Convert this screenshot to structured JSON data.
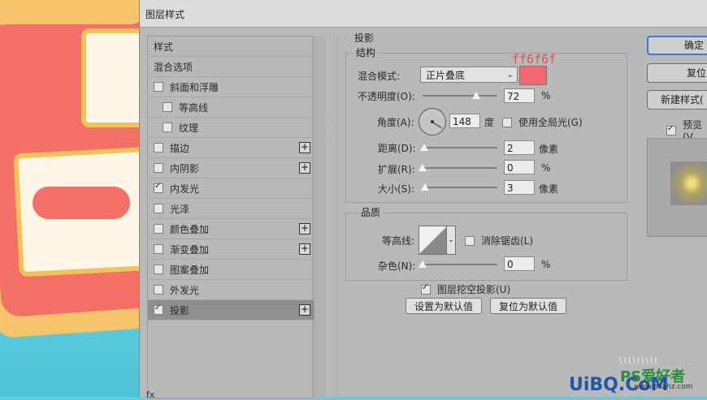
{
  "dialog": {
    "title": "图层样式"
  },
  "style_list": {
    "items": [
      {
        "label": "样式",
        "checkbox": false,
        "checked": false,
        "indent": 0,
        "plus": false,
        "active": false
      },
      {
        "label": "混合选项",
        "checkbox": false,
        "checked": false,
        "indent": 0,
        "plus": false,
        "active": false
      },
      {
        "label": "斜面和浮雕",
        "checkbox": true,
        "checked": false,
        "indent": 0,
        "plus": false,
        "active": false
      },
      {
        "label": "等高线",
        "checkbox": true,
        "checked": false,
        "indent": 1,
        "plus": false,
        "active": false
      },
      {
        "label": "纹理",
        "checkbox": true,
        "checked": false,
        "indent": 1,
        "plus": false,
        "active": false
      },
      {
        "label": "描边",
        "checkbox": true,
        "checked": false,
        "indent": 0,
        "plus": true,
        "active": false
      },
      {
        "label": "内阴影",
        "checkbox": true,
        "checked": false,
        "indent": 0,
        "plus": true,
        "active": false
      },
      {
        "label": "内发光",
        "checkbox": true,
        "checked": true,
        "indent": 0,
        "plus": false,
        "active": false
      },
      {
        "label": "光泽",
        "checkbox": true,
        "checked": false,
        "indent": 0,
        "plus": false,
        "active": false
      },
      {
        "label": "颜色叠加",
        "checkbox": true,
        "checked": false,
        "indent": 0,
        "plus": true,
        "active": false
      },
      {
        "label": "渐变叠加",
        "checkbox": true,
        "checked": false,
        "indent": 0,
        "plus": true,
        "active": false
      },
      {
        "label": "图案叠加",
        "checkbox": true,
        "checked": false,
        "indent": 0,
        "plus": false,
        "active": false
      },
      {
        "label": "外发光",
        "checkbox": true,
        "checked": false,
        "indent": 0,
        "plus": false,
        "active": false
      },
      {
        "label": "投影",
        "checkbox": true,
        "checked": true,
        "indent": 0,
        "plus": true,
        "active": true
      }
    ],
    "fx_label": "fx"
  },
  "drop_shadow": {
    "title": "投影",
    "structure": {
      "title": "结构",
      "blend_mode_label": "混合模式:",
      "blend_mode_value": "正片叠底",
      "color": "#f5676f",
      "color_annotation": "ff6f6f",
      "opacity_label": "不透明度(O):",
      "opacity_value": "72",
      "opacity_unit": "%",
      "angle_label": "角度(A):",
      "angle_value": "148",
      "angle_unit": "度",
      "global_light_label": "使用全局光(G)",
      "global_light_checked": false,
      "distance_label": "距离(D):",
      "distance_value": "2",
      "distance_unit": "像素",
      "spread_label": "扩展(R):",
      "spread_value": "0",
      "spread_unit": "%",
      "size_label": "大小(S):",
      "size_value": "3",
      "size_unit": "像素"
    },
    "quality": {
      "title": "品质",
      "contour_label": "等高线:",
      "antialias_label": "消除锯齿(L)",
      "antialias_checked": false,
      "noise_label": "杂色(N):",
      "noise_value": "0",
      "noise_unit": "%"
    },
    "knockout_label": "图层挖空投影(U)",
    "knockout_checked": true,
    "make_default_label": "设置为默认值",
    "reset_default_label": "复位为默认值"
  },
  "buttons": {
    "ok_label": "确定",
    "reset_label": "复位",
    "new_style_label": "新建样式(",
    "preview_label": "预览(V",
    "preview_checked": true
  },
  "watermark": {
    "line1": "\\II\\II\\II",
    "brand": "PS爱好者",
    "site": "UiBQ.CoM",
    "url": "www.psahz.com"
  }
}
